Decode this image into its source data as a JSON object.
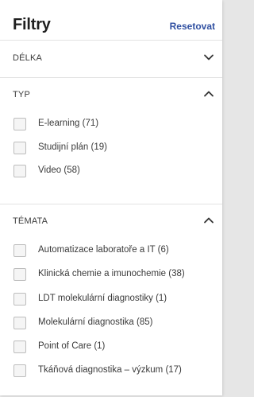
{
  "header": {
    "title": "Filtry",
    "reset_label": "Resetovat"
  },
  "sections": {
    "delka": {
      "label": "DÉLKA",
      "expanded": false,
      "icon": "chevron-down-icon"
    },
    "typ": {
      "label": "TYP",
      "expanded": true,
      "icon": "chevron-up-icon",
      "options": [
        {
          "label": "E-learning (71)",
          "checked": false
        },
        {
          "label": "Studijní plán (19)",
          "checked": false
        },
        {
          "label": "Video (58)",
          "checked": false
        }
      ]
    },
    "temata": {
      "label": "TÉMATA",
      "expanded": true,
      "icon": "chevron-up-icon",
      "options": [
        {
          "label": "Automatizace laboratoře a IT (6)",
          "checked": false
        },
        {
          "label": "Klinická chemie a imunochemie (38)",
          "checked": false
        },
        {
          "label": "LDT molekulární diagnostiky (1)",
          "checked": false
        },
        {
          "label": "Molekulární diagnostika (85)",
          "checked": false
        },
        {
          "label": "Point of Care (1)",
          "checked": false
        },
        {
          "label": "Tkáňová diagnostika – výzkum (17)",
          "checked": false
        }
      ]
    }
  },
  "colors": {
    "accent": "#2f4fa1",
    "text": "#3a3a3a",
    "divider": "#e3e3e3"
  }
}
